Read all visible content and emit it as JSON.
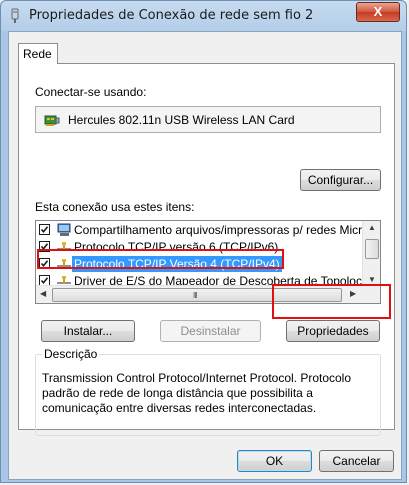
{
  "window": {
    "title": "Propriedades de Conexão de rede sem fio 2",
    "close_label": "X"
  },
  "tabs": [
    {
      "label": "Rede"
    }
  ],
  "connect_using": {
    "label": "Conectar-se usando:",
    "adapter_name": "Hercules 802.11n USB Wireless LAN Card",
    "configure_button": "Configurar..."
  },
  "items_section": {
    "label": "Esta conexão usa estes itens:",
    "items": [
      {
        "label": "Compartilhamento arquivos/impressoras p/ redes Micro",
        "checked": true,
        "icon": "share-icon",
        "selected": false
      },
      {
        "label": "Protocolo TCP/IP versão 6 (TCP/IPv6)",
        "checked": true,
        "icon": "network-protocol-icon",
        "selected": false
      },
      {
        "label": "Protocolo TCP/IP Versão 4 (TCP/IPv4)",
        "checked": true,
        "icon": "network-protocol-icon",
        "selected": true
      },
      {
        "label": "Driver de E/S do Mapeador de Descoberta de Topoloc",
        "checked": true,
        "icon": "network-protocol-icon",
        "selected": false
      }
    ]
  },
  "buttons": {
    "install": "Instalar...",
    "uninstall": "Desinstalar",
    "properties": "Propriedades",
    "ok": "OK",
    "cancel": "Cancelar"
  },
  "description": {
    "title": "Descrição",
    "text": "Transmission Control Protocol/Internet Protocol. Protocolo padrão de rede de longa distância que possibilita a comunicação entre diversas redes interconectadas."
  },
  "colors": {
    "highlight": "#e01010",
    "selection": "#3399ff"
  }
}
